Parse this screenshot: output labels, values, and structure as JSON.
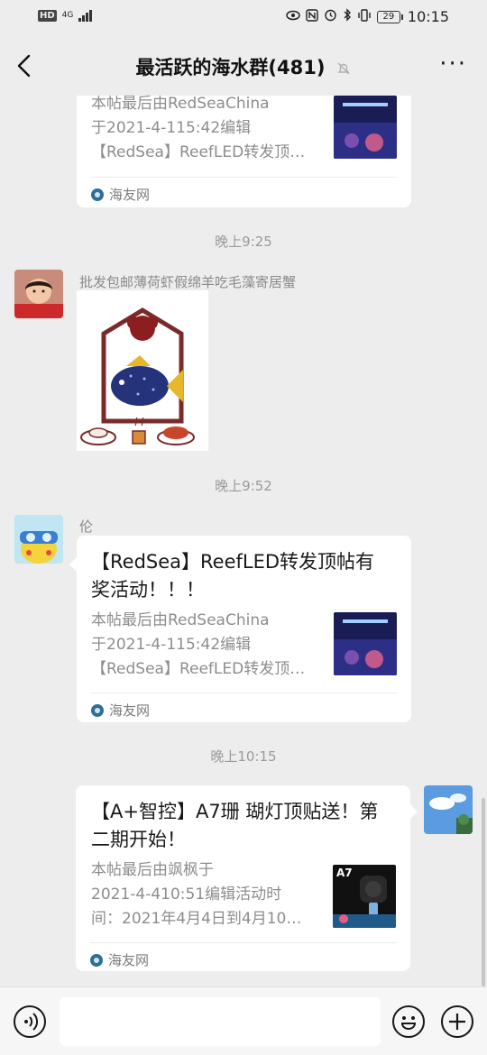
{
  "status_bar": {
    "hd": "HD",
    "network": "4G",
    "battery": "29",
    "time": "10:15"
  },
  "header": {
    "title": "最活跃的海水群(481)",
    "back_icon": "chevron-left-icon",
    "mute_icon": "bell-off-icon",
    "more_label": "···"
  },
  "messages": {
    "card1": {
      "desc_lines": [
        "本帖最后由RedSeaChina",
        "于2021-4-115:42编辑",
        "【RedSea】ReefLED转发顶…"
      ],
      "source": "海友网"
    },
    "time1": "晚上9:25",
    "msg2": {
      "nickname": "批发包邮薄荷虾假绵羊吃毛藻寄居蟹"
    },
    "time2": "晚上9:52",
    "card3": {
      "nickname": "伦",
      "title_lines": [
        "【RedSea】ReefLED转发顶帖有",
        "奖活动！！！"
      ],
      "desc_lines": [
        "本帖最后由RedSeaChina",
        "于2021-4-115:42编辑",
        "【RedSea】ReefLED转发顶…"
      ],
      "source": "海友网"
    },
    "time3": "晚上10:15",
    "card4": {
      "title_lines": [
        "【A+智控】A7珊 瑚灯顶贴送！第",
        "二期开始！"
      ],
      "desc_lines": [
        "本帖最后由飒枫于",
        "2021-4-410:51编辑活动时",
        "间：2021年4月4日到4月10…"
      ],
      "source": "海友网",
      "thumb_label": "A7"
    }
  },
  "input_bar": {
    "voice_icon": "voice-icon",
    "emoji_icon": "emoji-icon",
    "plus_icon": "plus-icon",
    "text_value": ""
  }
}
